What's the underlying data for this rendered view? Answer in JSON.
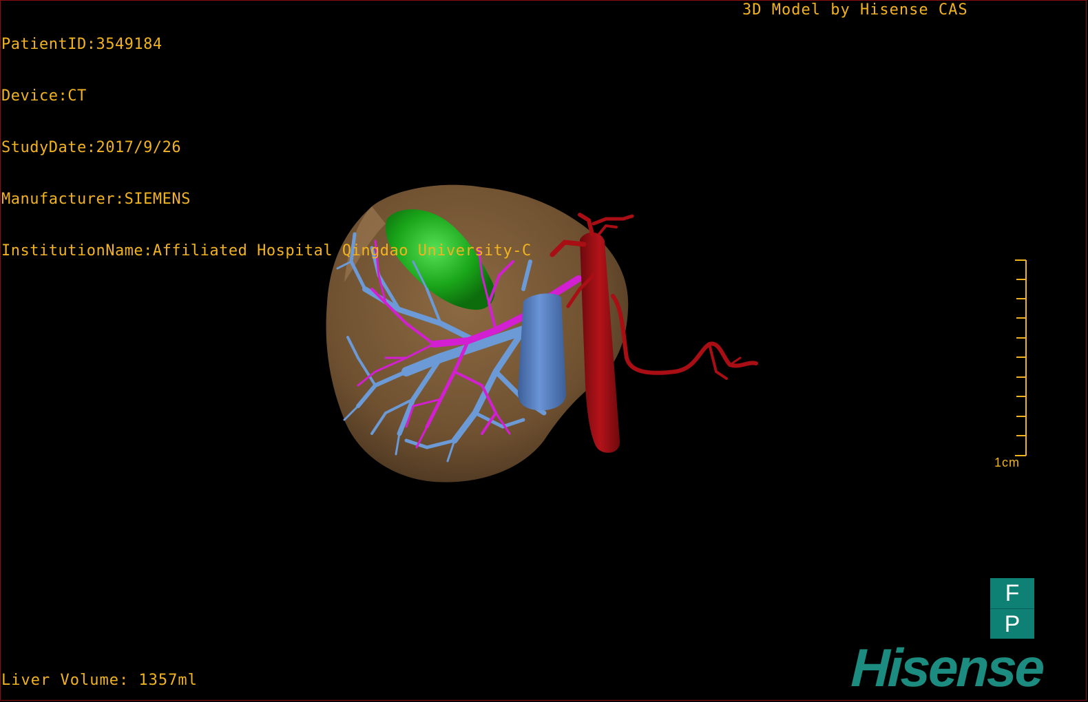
{
  "study_info": {
    "patient_id": "PatientID:3549184",
    "device": "Device:CT",
    "study_date": "StudyDate:2017/9/26",
    "manufacturer": "Manufacturer:SIEMENS",
    "institution": "InstitutionName:Affiliated Hospital Qingdao University-C"
  },
  "credit": "3D Model by Hisense CAS",
  "liver_volume": "Liver Volume: 1357ml",
  "scale_bar": {
    "label": "1cm",
    "ticks": 10,
    "color": "#f2b320"
  },
  "orientation_cube": {
    "top": "F",
    "bottom": "P",
    "color": "#0f8074"
  },
  "logo_text": "Hisense",
  "colors": {
    "text": "#f2b320",
    "liver": "#7a5a36",
    "gallbladder": "#1ea21e",
    "portal_vein": "#6b9ad6",
    "hepatic_artery": "#d21fd2",
    "inferior_vena_cava_artery": "#a80e14",
    "ivc": "#5d86c4",
    "brand": "#1d8c80"
  },
  "model_parts": [
    "liver",
    "gallbladder",
    "portal-vein",
    "hepatic-artery",
    "aorta",
    "vena-cava"
  ]
}
